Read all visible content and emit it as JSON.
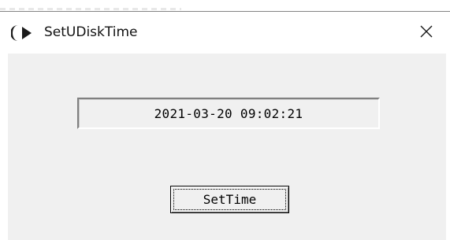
{
  "window": {
    "title": "SetUDiskTime",
    "icon": "crescent-arrow-app-icon",
    "close_icon": "close-icon"
  },
  "main": {
    "time_value": "2021-03-20 09:02:21",
    "set_button_label": "SetTime"
  },
  "colors": {
    "client_background": "#f0f0f0",
    "title_background": "#ffffff",
    "text": "#000000"
  }
}
